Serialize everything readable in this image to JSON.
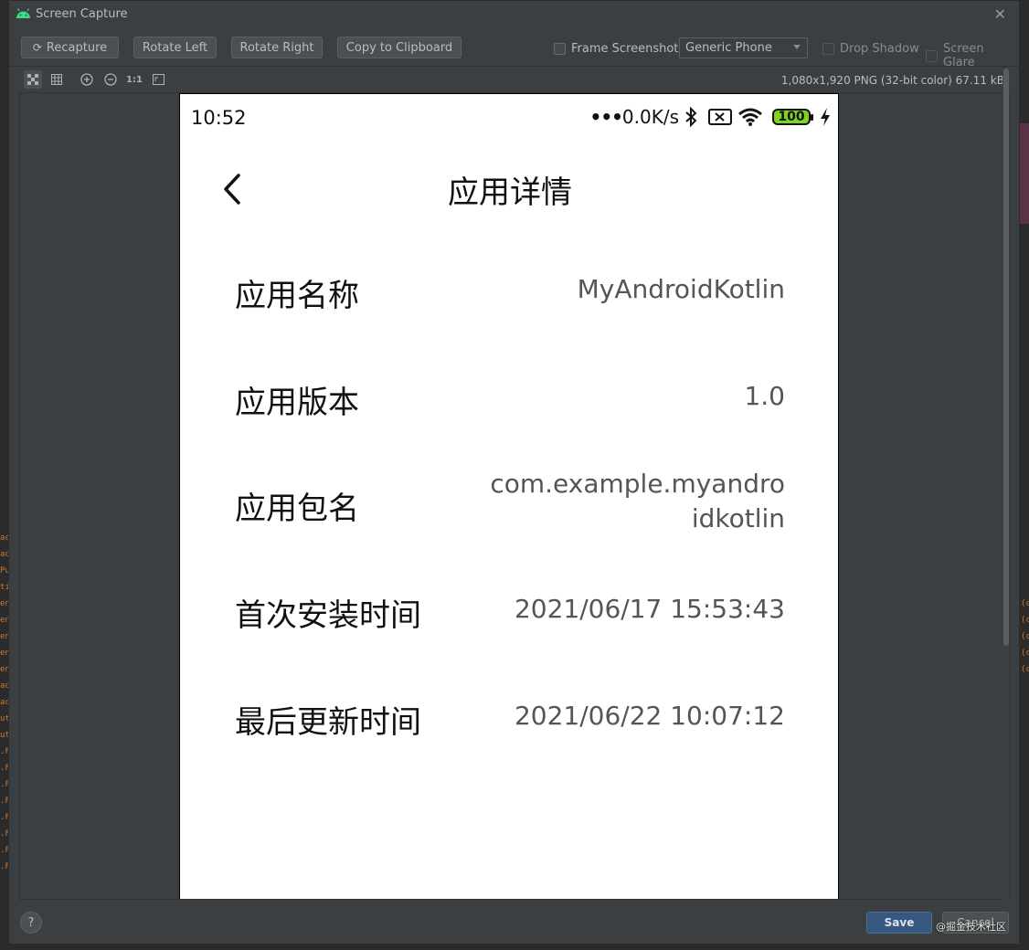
{
  "window": {
    "title": "Screen Capture"
  },
  "toolbar": {
    "recapture": "Recapture",
    "rotate_left": "Rotate Left",
    "rotate_right": "Rotate Right",
    "copy": "Copy to Clipboard",
    "frame_screenshot": "Frame Screenshot",
    "device": "Generic Phone",
    "drop_shadow": "Drop Shadow",
    "screen_glare": "Screen Glare"
  },
  "image_info": "1,080x1,920 PNG (32-bit color) 67.11 kB",
  "zoom": {
    "actual_size": "1:1"
  },
  "phone": {
    "time": "10:52",
    "net_speed": "0.0K/s",
    "battery": "100",
    "page_title": "应用详情",
    "rows": [
      {
        "label": "应用名称",
        "value": "MyAndroidKotlin"
      },
      {
        "label": "应用版本",
        "value": "1.0"
      },
      {
        "label": "应用包名",
        "value": "com.example.myandroidkotlin"
      },
      {
        "label": "首次安装时间",
        "value": "2021/06/17 15:53:43"
      },
      {
        "label": "最后更新时间",
        "value": "2021/06/22 10:07:12"
      }
    ]
  },
  "footer": {
    "help": "?",
    "save": "Save",
    "cancel": "Cancel",
    "watermark": "@掘金技术社区"
  },
  "colors": {
    "accent": "#365880",
    "battery": "#7fd321"
  }
}
